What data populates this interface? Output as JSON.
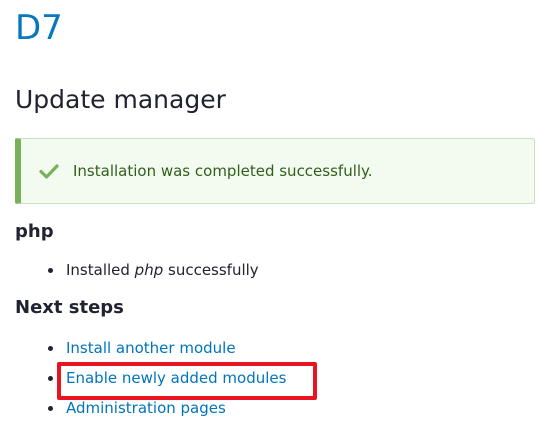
{
  "site": {
    "name": "D7"
  },
  "page": {
    "title": "Update manager"
  },
  "status": {
    "message": "Installation was completed successfully.",
    "icon": "check-icon",
    "accent_color": "#77b259"
  },
  "module_section": {
    "heading": "php",
    "result": {
      "prefix": "Installed ",
      "module": "php",
      "suffix": " successfully"
    }
  },
  "next_steps": {
    "heading": "Next steps",
    "links": [
      {
        "label": "Install another module"
      },
      {
        "label": "Enable newly added modules",
        "highlighted": true
      },
      {
        "label": "Administration pages"
      }
    ]
  },
  "colors": {
    "link": "#0074bd",
    "highlight": "#e8141f"
  }
}
